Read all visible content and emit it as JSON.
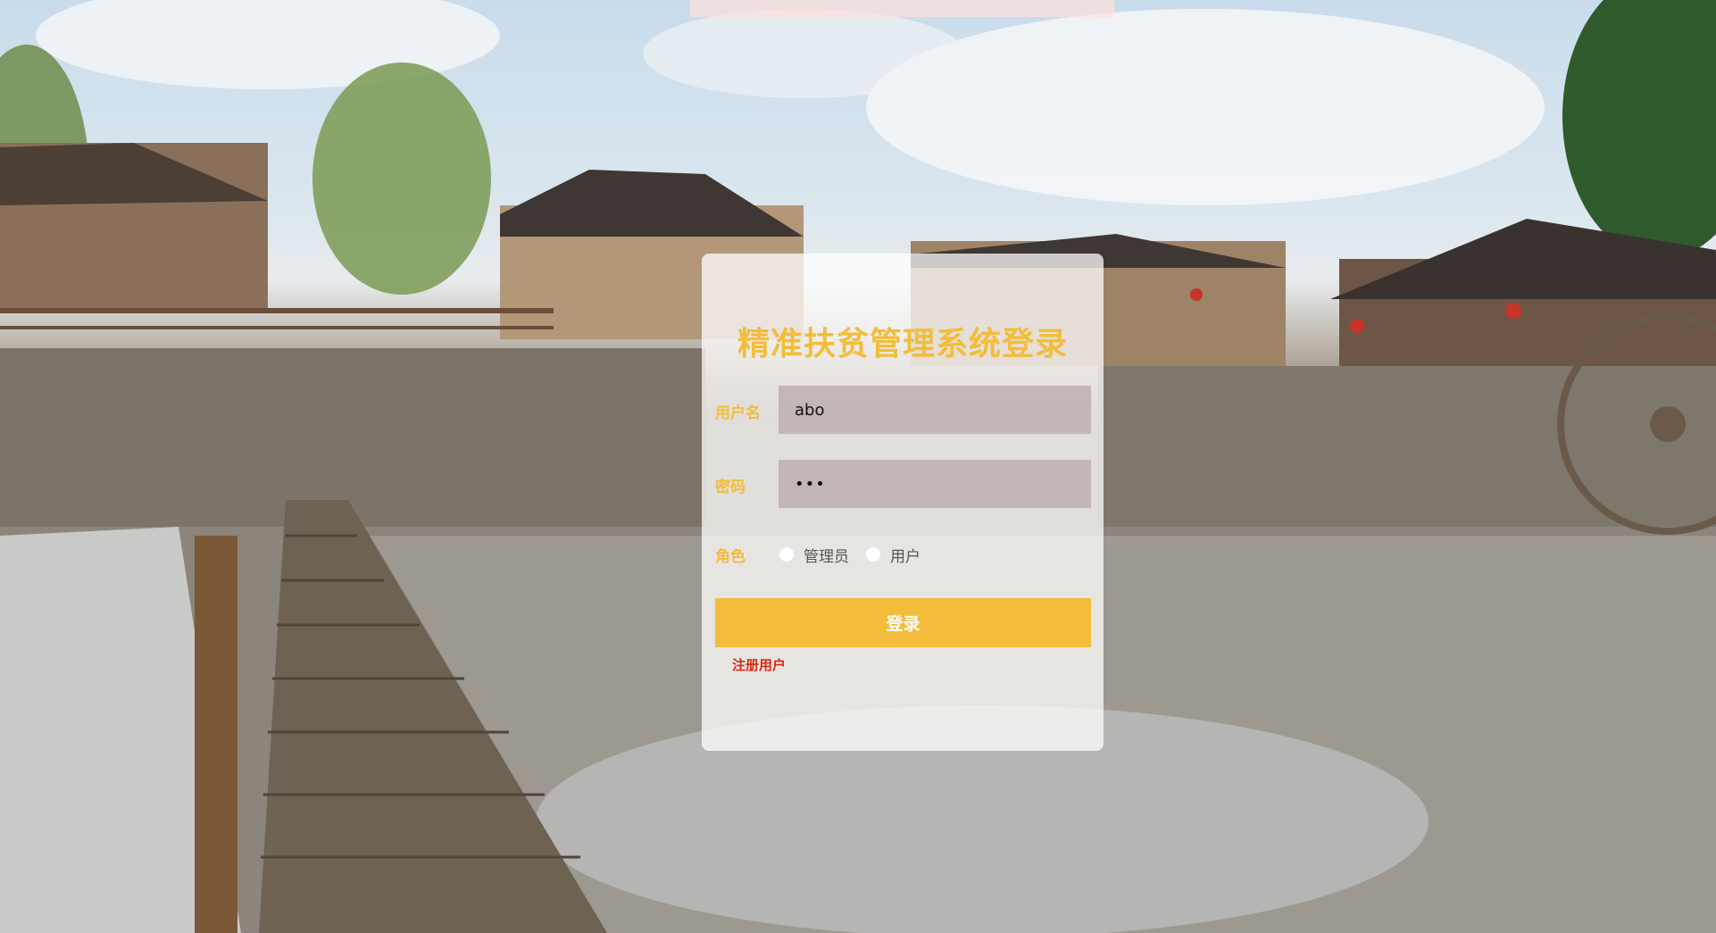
{
  "background": {
    "scene": "village-riverside-photo"
  },
  "login": {
    "title": "精准扶贫管理系统登录",
    "username_label": "用户名",
    "username_value": "abo",
    "password_label": "密码",
    "password_value": "•••",
    "role_label": "角色",
    "role_options": [
      "管理员",
      "用户"
    ],
    "submit_label": "登录",
    "register_label": "注册用户"
  },
  "colors": {
    "accent": "#f2bd3a",
    "register_link": "#d42a14",
    "input_bg": "#aa9696"
  }
}
